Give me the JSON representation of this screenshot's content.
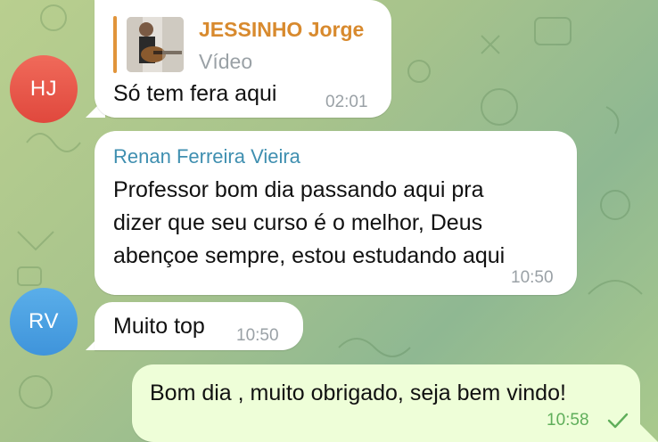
{
  "messages": [
    {
      "avatar_initials": "HJ",
      "reply": {
        "author": "JESSINHO Jorge",
        "type": "Vídeo"
      },
      "text": "Só tem fera aqui",
      "time": "02:01"
    },
    {
      "sender": "Renan Ferreira Vieira",
      "text_lines": [
        "Professor bom dia passando aqui pra",
        "dizer que seu curso é o melhor, Deus",
        "abençoe sempre, estou estudando aqui"
      ],
      "time": "10:50"
    },
    {
      "avatar_initials": "RV",
      "text": "Muito top",
      "time": "10:50"
    },
    {
      "outgoing": true,
      "text": "Bom dia , muito obrigado, seja bem vindo!",
      "time": "10:58",
      "status_icon": "single-check-icon"
    }
  ],
  "colors": {
    "incoming_bubble": "#ffffff",
    "outgoing_bubble": "#eefed8",
    "sender_name": "#3f8fb0",
    "reply_author": "#d88a2e",
    "avatar_hj": "#e8523f",
    "avatar_rv": "#4a9fe2",
    "read_check": "#5fae5a"
  }
}
